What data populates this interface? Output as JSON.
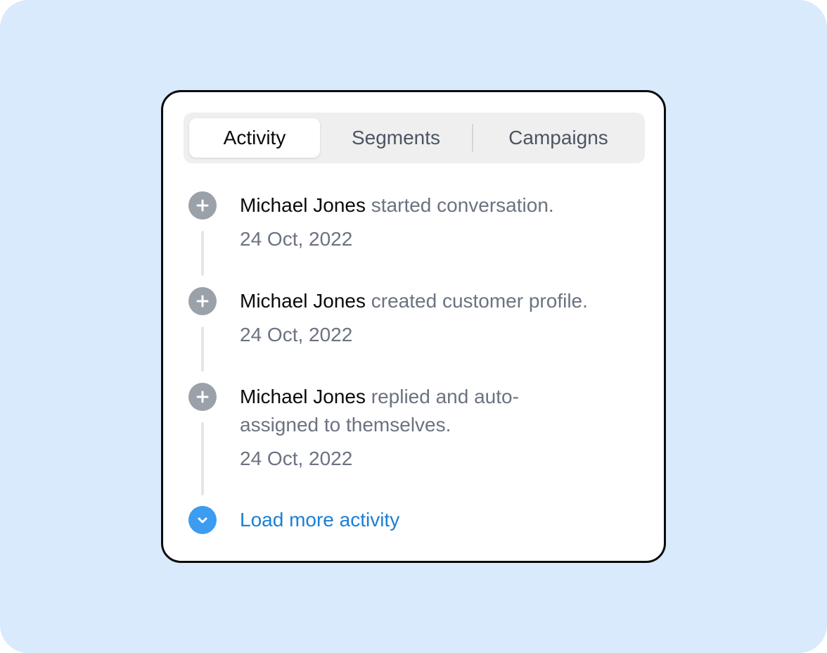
{
  "tabs": [
    {
      "label": "Activity",
      "active": true
    },
    {
      "label": "Segments",
      "active": false
    },
    {
      "label": "Campaigns",
      "active": false
    }
  ],
  "activity": [
    {
      "actor": "Michael Jones",
      "action": "started conversation.",
      "date": "24 Oct, 2022",
      "icon": "plus-circle-icon"
    },
    {
      "actor": "Michael Jones",
      "action": "created customer profile.",
      "date": "24 Oct, 2022",
      "icon": "plus-circle-icon"
    },
    {
      "actor": "Michael Jones",
      "action": "replied and auto-assigned to themselves.",
      "date": "24 Oct, 2022",
      "icon": "plus-circle-icon"
    }
  ],
  "load_more": {
    "label": "Load more activity",
    "icon": "chevron-down-circle-icon"
  },
  "colors": {
    "background": "#d8eafc",
    "card_border": "#0b0b0b",
    "icon_gray": "#9aa1a9",
    "accent_blue": "#3b9cf0",
    "link_blue": "#1b7fd8",
    "muted_text": "#6b7280"
  }
}
